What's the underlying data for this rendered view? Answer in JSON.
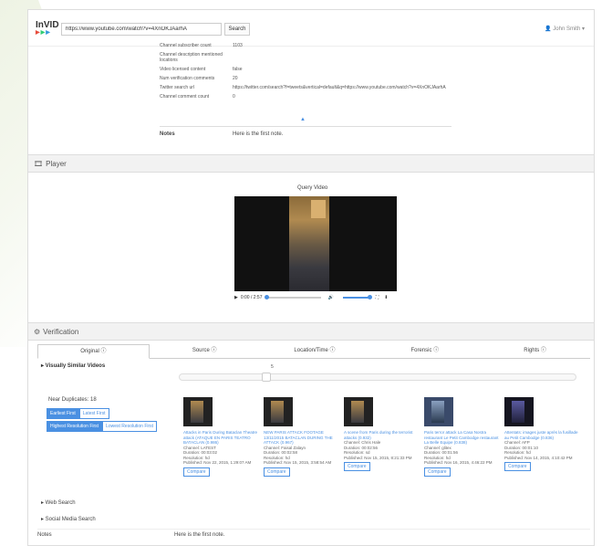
{
  "app": {
    "logo_text": "InVID",
    "logo_dots": "▶▶▶"
  },
  "topbar": {
    "url_value": "https://www.youtube.com/watch?v=4XnOKJAarhA",
    "search_label": "Search",
    "user_label": "John Smith ▾"
  },
  "metadata": {
    "rows": [
      {
        "key": "Channel subscriber count",
        "value": "1103"
      },
      {
        "key": "Channel description mentioned locations",
        "value": ""
      },
      {
        "key": "Video licensed content",
        "value": "false"
      },
      {
        "key": "Num verification comments",
        "value": "20"
      },
      {
        "key": "Twitter search url",
        "value": "https://twitter.com/search?f=tweets&vertical=default&q=https://www.youtube.com/watch?v=4XnOKJAarhA"
      },
      {
        "key": "Channel comment count",
        "value": "0"
      }
    ]
  },
  "notes_top": {
    "label": "Notes",
    "value": "Here is the first note."
  },
  "player": {
    "header": "Player",
    "query_title": "Query Video",
    "time": "0:00 / 2:57",
    "progress_fraction": 0.0
  },
  "verification": {
    "header": "Verification",
    "tabs": [
      {
        "label": "Original ⓘ",
        "active": true
      },
      {
        "label": "Source ⓘ",
        "active": false
      },
      {
        "label": "Location/Time ⓘ",
        "active": false
      },
      {
        "label": "Forensic ⓘ",
        "active": false
      },
      {
        "label": "Rights ⓘ",
        "active": false
      }
    ],
    "visually_similar_title": "▸ Visually Similar Videos",
    "slider_value": "5",
    "slider_fraction": 0.22,
    "near_duplicates_label": "Near Duplicates: 18",
    "sort_first": {
      "a": "Earliest First",
      "b": "Latest First"
    },
    "sort_second": {
      "a": "Highest Resolution First",
      "b": "Lowest Resolution First"
    },
    "results": [
      {
        "title": "Attacks in Paris During Bataclan Theatre attack (ATAQUE EN PARIS TEATRO BATACLAN (0.986)",
        "channel": "Channel: LATEST",
        "duration": "Duration: 00:03:02",
        "resolution": "Resolution: hd",
        "published": "Published: Nov 22, 2015, 1:29:07 AM",
        "compare": "Compare"
      },
      {
        "title": "NEW PARIS ATTACK FOOTAGE 13/11/2015 BATACLAN DURING THE ATTACK (0.967)",
        "channel": "Channel: Faisal Zalayn",
        "duration": "Duration: 00:02:58",
        "resolution": "Resolution: hd",
        "published": "Published: Nov 15, 2015, 3:58:54 AM",
        "compare": "Compare"
      },
      {
        "title": "A scene from Paris during the terrorist attacks (0.932)",
        "channel": "Channel: Chris Hale",
        "duration": "Duration: 00:02:56",
        "resolution": "Resolution: sd",
        "published": "Published: Nov 15, 2015, 8:21:33 PM",
        "compare": "Compare"
      },
      {
        "title": "Paris terror attack La Casa Nostra restaurant Le Petit Cambodge restaurant La Belle Equipe (0.838)",
        "channel": "Channel: glitex",
        "duration": "Duration: 00:01:56",
        "resolution": "Resolution: hd",
        "published": "Published: Nov 16, 2015, 4:46:22 PM",
        "compare": "Compare"
      },
      {
        "title": "Attentats: images juste après la fusillade au Petit Cambodge (0.836)",
        "channel": "Channel: AFP",
        "duration": "Duration: 00:01:10",
        "resolution": "Resolution: hd",
        "published": "Published: Nov 14, 2015, 4:10:42 PM",
        "compare": "Compare"
      }
    ],
    "web_search": "▸ Web Search",
    "social_media_search": "▸ Social Media Search"
  },
  "notes_bottom": {
    "label": "Notes",
    "value": "Here is the first note."
  },
  "colors": {
    "accent": "#4a90e2",
    "header_bg": "#f2f2f2"
  }
}
